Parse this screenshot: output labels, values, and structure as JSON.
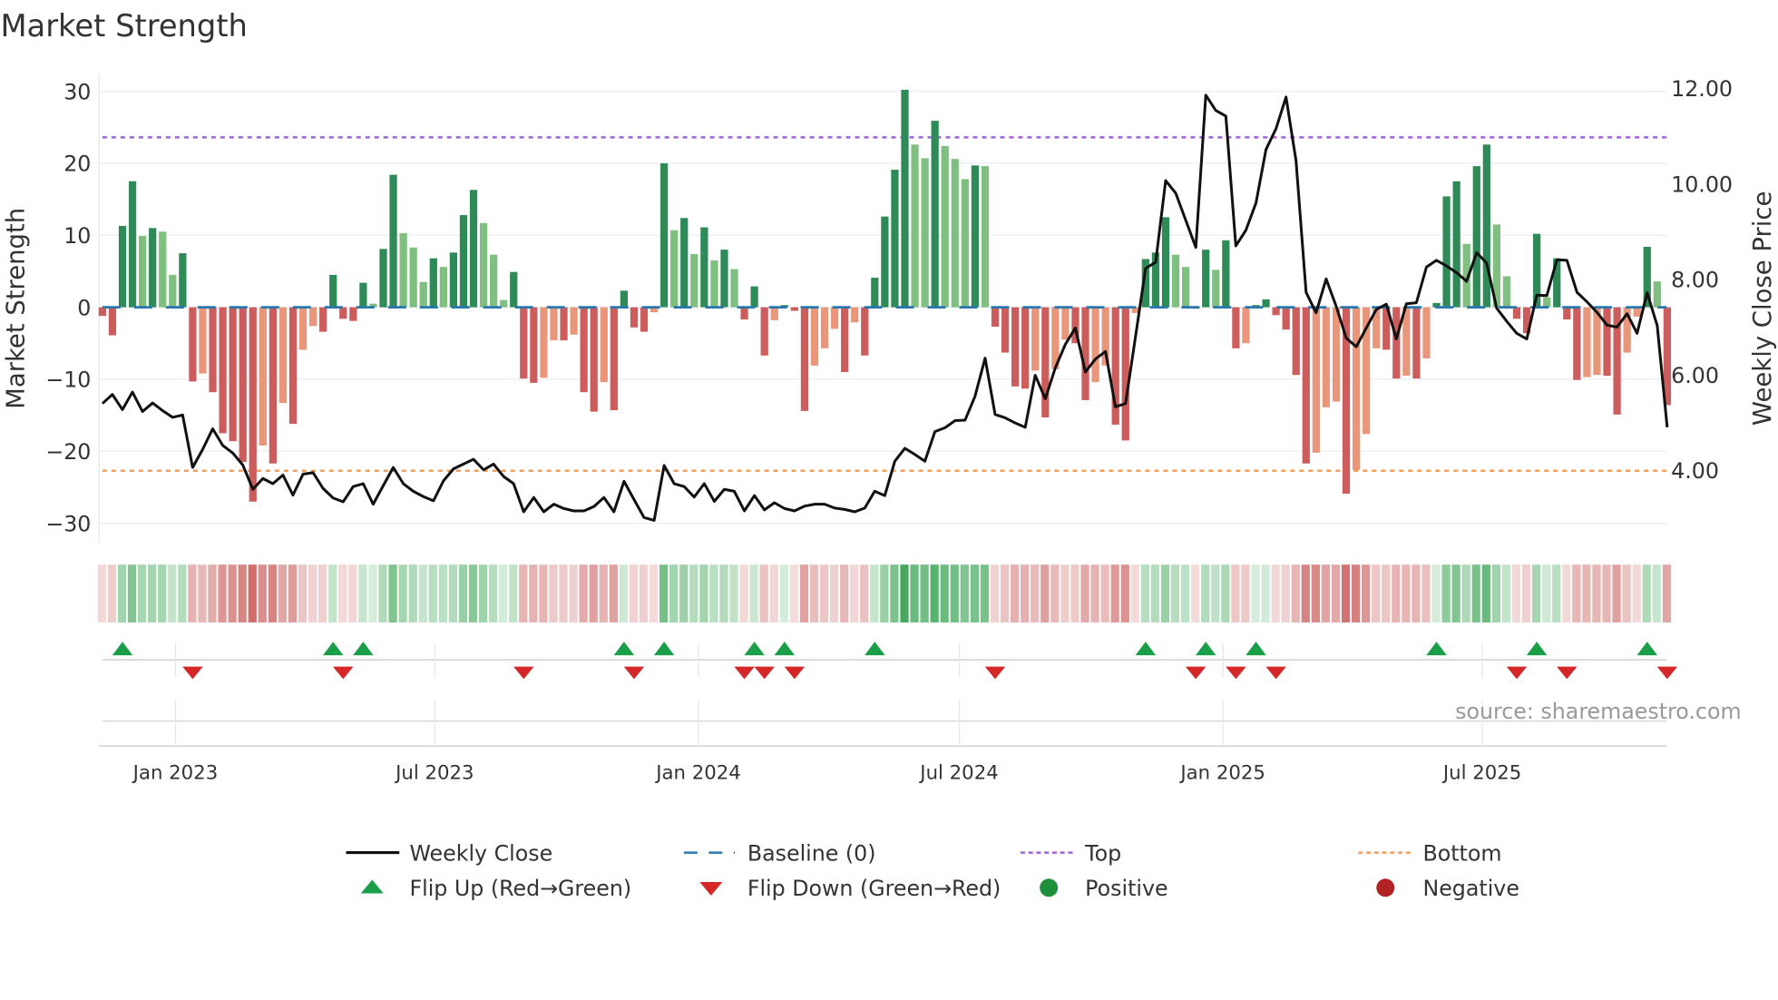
{
  "chart_data": {
    "type": "bar",
    "title": "Market Strength",
    "ylabel": "Market Strength",
    "ylabel_right": "Weekly Close Price",
    "ylim": [
      -32,
      33
    ],
    "yticks": [
      30,
      20,
      10,
      0,
      -10,
      -20,
      -30
    ],
    "ytick_labels": [
      "30",
      "20",
      "10",
      "0",
      "−10",
      "−20",
      "−30"
    ],
    "ylim_right": [
      2.6,
      12.4
    ],
    "yticks_right": [
      12,
      10,
      8,
      6,
      4
    ],
    "ytick_labels_right": [
      "12.00",
      "10.00",
      "8.00",
      "6.00",
      "4.00"
    ],
    "x_start": "2022-11-11",
    "x_step_days": 7,
    "xticks": [
      {
        "date": "2023-01-01",
        "label": "Jan 2023"
      },
      {
        "date": "2023-07-01",
        "label": "Jul 2023"
      },
      {
        "date": "2024-01-01",
        "label": "Jan 2024"
      },
      {
        "date": "2024-07-01",
        "label": "Jul 2024"
      },
      {
        "date": "2025-01-01",
        "label": "Jan 2025"
      },
      {
        "date": "2025-07-01",
        "label": "Jul 2025"
      }
    ],
    "top_level": 23.6,
    "bottom_level": -22.7,
    "baseline": 0,
    "grid": true,
    "legend_placement": "bottom",
    "series": [
      {
        "name": "Market Strength",
        "type": "bar",
        "values": [
          -1.2,
          -3.9,
          11.3,
          17.5,
          9.9,
          11.0,
          10.5,
          4.5,
          7.5,
          -10.3,
          -9.2,
          -11.8,
          -17.5,
          -18.6,
          -21.5,
          -27.0,
          -19.2,
          -21.7,
          -13.3,
          -16.2,
          -5.9,
          -2.6,
          -3.4,
          4.5,
          -1.6,
          -1.9,
          3.4,
          0.5,
          8.1,
          18.4,
          10.3,
          8.3,
          3.5,
          6.8,
          5.6,
          7.6,
          12.8,
          16.3,
          11.7,
          7.3,
          1.0,
          4.9,
          -9.9,
          -10.5,
          -9.8,
          -4.6,
          -4.6,
          -3.8,
          -11.8,
          -14.5,
          -10.4,
          -14.3,
          2.3,
          -2.8,
          -3.4,
          -0.7,
          20.0,
          10.7,
          12.4,
          7.4,
          11.1,
          6.5,
          8.0,
          5.3,
          -1.7,
          2.9,
          -6.7,
          -1.8,
          0.3,
          -0.5,
          -14.4,
          -8.1,
          -5.7,
          -3.0,
          -9.0,
          -2.1,
          -6.7,
          4.1,
          12.6,
          19.1,
          30.2,
          22.6,
          20.7,
          25.9,
          22.4,
          20.6,
          17.8,
          19.7,
          19.6,
          -2.7,
          -6.3,
          -11.0,
          -11.3,
          -8.8,
          -15.3,
          -8.6,
          -4.5,
          -5.0,
          -12.9,
          -10.4,
          -8.1,
          -16.3,
          -18.5,
          -0.8,
          6.7,
          7.6,
          12.5,
          7.3,
          5.6,
          -0.2,
          8.0,
          5.2,
          9.3,
          -5.7,
          -5.0,
          0.3,
          1.1,
          -1.1,
          -3.1,
          -9.4,
          -21.7,
          -20.2,
          -13.9,
          -13.1,
          -25.9,
          -22.6,
          -17.6,
          -5.7,
          -5.9,
          -9.9,
          -9.5,
          -9.9,
          -7.1,
          0.6,
          15.4,
          17.5,
          8.8,
          19.6,
          22.6,
          11.5,
          4.3,
          -1.6,
          -3.6,
          10.2,
          1.4,
          6.8,
          -1.7,
          -10.1,
          -9.7,
          -9.4,
          -9.5,
          -14.9,
          -6.3,
          -1.3,
          8.4,
          3.6,
          -13.6
        ]
      },
      {
        "name": "Weekly Close",
        "type": "line",
        "axis": "right",
        "values": [
          5.4,
          5.59,
          5.27,
          5.64,
          5.23,
          5.41,
          5.25,
          5.11,
          5.16,
          4.06,
          4.44,
          4.87,
          4.52,
          4.36,
          4.11,
          3.6,
          3.83,
          3.72,
          3.9,
          3.48,
          3.92,
          3.95,
          3.62,
          3.42,
          3.34,
          3.66,
          3.72,
          3.29,
          3.68,
          4.06,
          3.72,
          3.56,
          3.45,
          3.36,
          3.78,
          4.03,
          4.13,
          4.23,
          4.01,
          4.13,
          3.87,
          3.72,
          3.13,
          3.43,
          3.13,
          3.29,
          3.2,
          3.15,
          3.15,
          3.24,
          3.43,
          3.13,
          3.77,
          3.39,
          3.01,
          2.95,
          4.1,
          3.72,
          3.66,
          3.44,
          3.72,
          3.35,
          3.6,
          3.56,
          3.15,
          3.47,
          3.17,
          3.32,
          3.2,
          3.15,
          3.25,
          3.29,
          3.29,
          3.21,
          3.18,
          3.13,
          3.21,
          3.56,
          3.47,
          4.19,
          4.46,
          4.33,
          4.19,
          4.81,
          4.89,
          5.04,
          5.05,
          5.55,
          6.35,
          5.17,
          5.1,
          4.99,
          4.9,
          5.99,
          5.5,
          6.15,
          6.64,
          6.98,
          6.06,
          6.33,
          6.49,
          5.33,
          5.4,
          6.8,
          8.23,
          8.36,
          10.07,
          9.81,
          9.24,
          8.67,
          11.86,
          11.54,
          11.42,
          8.7,
          9.03,
          9.6,
          10.72,
          11.16,
          11.82,
          10.49,
          7.73,
          7.3,
          8.01,
          7.44,
          6.77,
          6.59,
          6.98,
          7.37,
          7.48,
          6.75,
          7.49,
          7.51,
          8.26,
          8.4,
          8.28,
          8.14,
          7.96,
          8.56,
          8.34,
          7.4,
          7.12,
          6.87,
          6.75,
          7.67,
          7.66,
          8.41,
          8.4,
          7.73,
          7.53,
          7.31,
          7.04,
          7.0,
          7.28,
          6.87,
          7.72,
          7.03,
          4.9
        ]
      }
    ],
    "legend": [
      {
        "label": "Weekly Close",
        "symbol": "solid-line",
        "color": "#111111"
      },
      {
        "label": "Baseline (0)",
        "symbol": "dashed-line",
        "color": "#2a77ad"
      },
      {
        "label": "Top",
        "symbol": "dotted-line",
        "color": "#a060e0"
      },
      {
        "label": "Bottom",
        "symbol": "dotted-line",
        "color": "#f0a05a"
      },
      {
        "label": "Flip Up (Red→Green)",
        "symbol": "triangle-up",
        "color": "#1a9e48"
      },
      {
        "label": "Flip Down (Green→Red)",
        "symbol": "triangle-down",
        "color": "#d62728"
      },
      {
        "label": "Positive",
        "symbol": "circle",
        "color": "#1e8f3a"
      },
      {
        "label": "Negative",
        "symbol": "circle",
        "color": "#b22222"
      }
    ],
    "source": "source: sharemaestro.com"
  },
  "colors": {
    "pos_up": "#2e8b57",
    "pos_down": "#7fbf7f",
    "neg_down": "#cd5c5c",
    "neg_up": "#e9967a",
    "line": "#111111",
    "top": "#a060e0",
    "bottom": "#f0a05a",
    "baseline": "#2a77ad",
    "flip_up": "#1a9e48",
    "flip_down": "#d62728"
  }
}
